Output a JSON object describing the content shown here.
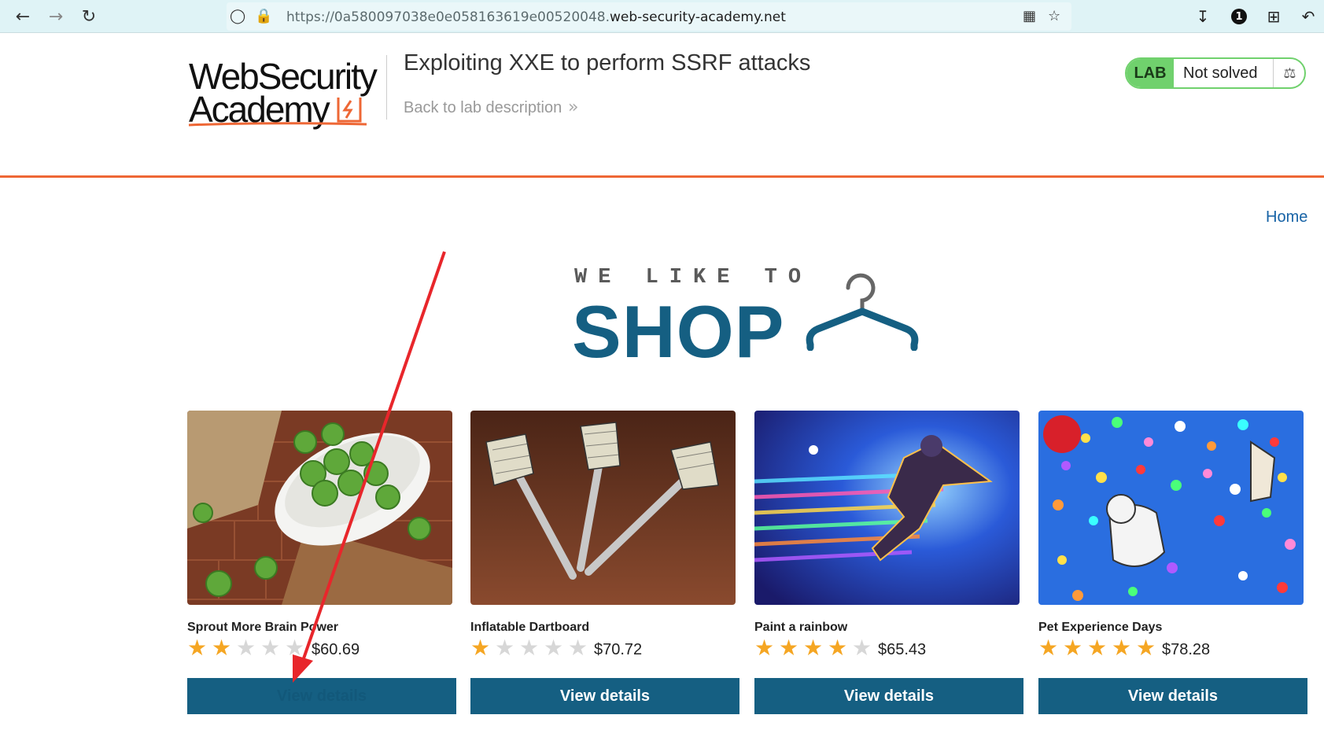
{
  "browser": {
    "url_prefix": "https://0a580097038e0e058163619e00520048.",
    "url_host": "web-security-academy.net",
    "profile_badge": "1"
  },
  "header": {
    "logo_line1": "WebSecurity",
    "logo_line2": "Academy",
    "lab_title": "Exploiting XXE to perform SSRF attacks",
    "back_link": "Back to lab description",
    "lab_tag": "LAB",
    "lab_status": "Not solved"
  },
  "nav": {
    "home": "Home"
  },
  "hero": {
    "tagline": "WE LIKE TO",
    "shop": "SHOP"
  },
  "products": [
    {
      "name": "Sprout More Brain Power",
      "price": "$60.69",
      "rating": 2,
      "button": "View details"
    },
    {
      "name": "Inflatable Dartboard",
      "price": "$70.72",
      "rating": 1,
      "button": "View details"
    },
    {
      "name": "Paint a rainbow",
      "price": "$65.43",
      "rating": 4,
      "button": "View details"
    },
    {
      "name": "Pet Experience Days",
      "price": "$78.28",
      "rating": 5,
      "button": "View details"
    }
  ],
  "colors": {
    "accent": "#155f82",
    "brand_orange": "#ee6735",
    "lab_green": "#70d16d",
    "star": "#f5a623",
    "annotation_arrow": "#e8262b"
  }
}
